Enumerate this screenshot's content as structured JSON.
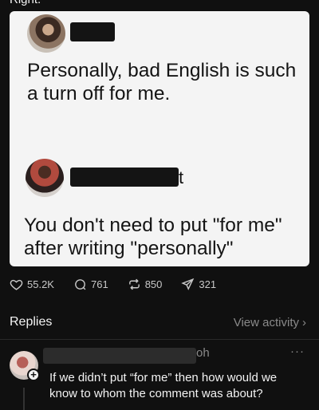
{
  "top_cut_text": "Right.",
  "post": {
    "first_message": "Personally, bad English is such a turn off for me.",
    "second_tail": "t",
    "second_message": "You don't need to put \"for me\" after writing \"personally\""
  },
  "actions": {
    "likes": "55.2K",
    "comments": "761",
    "reposts": "850",
    "shares": "321"
  },
  "replies": {
    "title": "Replies",
    "view_activity": "View activity",
    "item": {
      "name_tail": "oh",
      "more": "···",
      "text": "If we didn’t put “for me” then how would we know to whom the comment was about?"
    }
  },
  "icons": [
    "heart-icon",
    "comment-icon",
    "repost-icon",
    "share-icon",
    "chevron-right-icon",
    "more-icon",
    "plus-icon"
  ]
}
